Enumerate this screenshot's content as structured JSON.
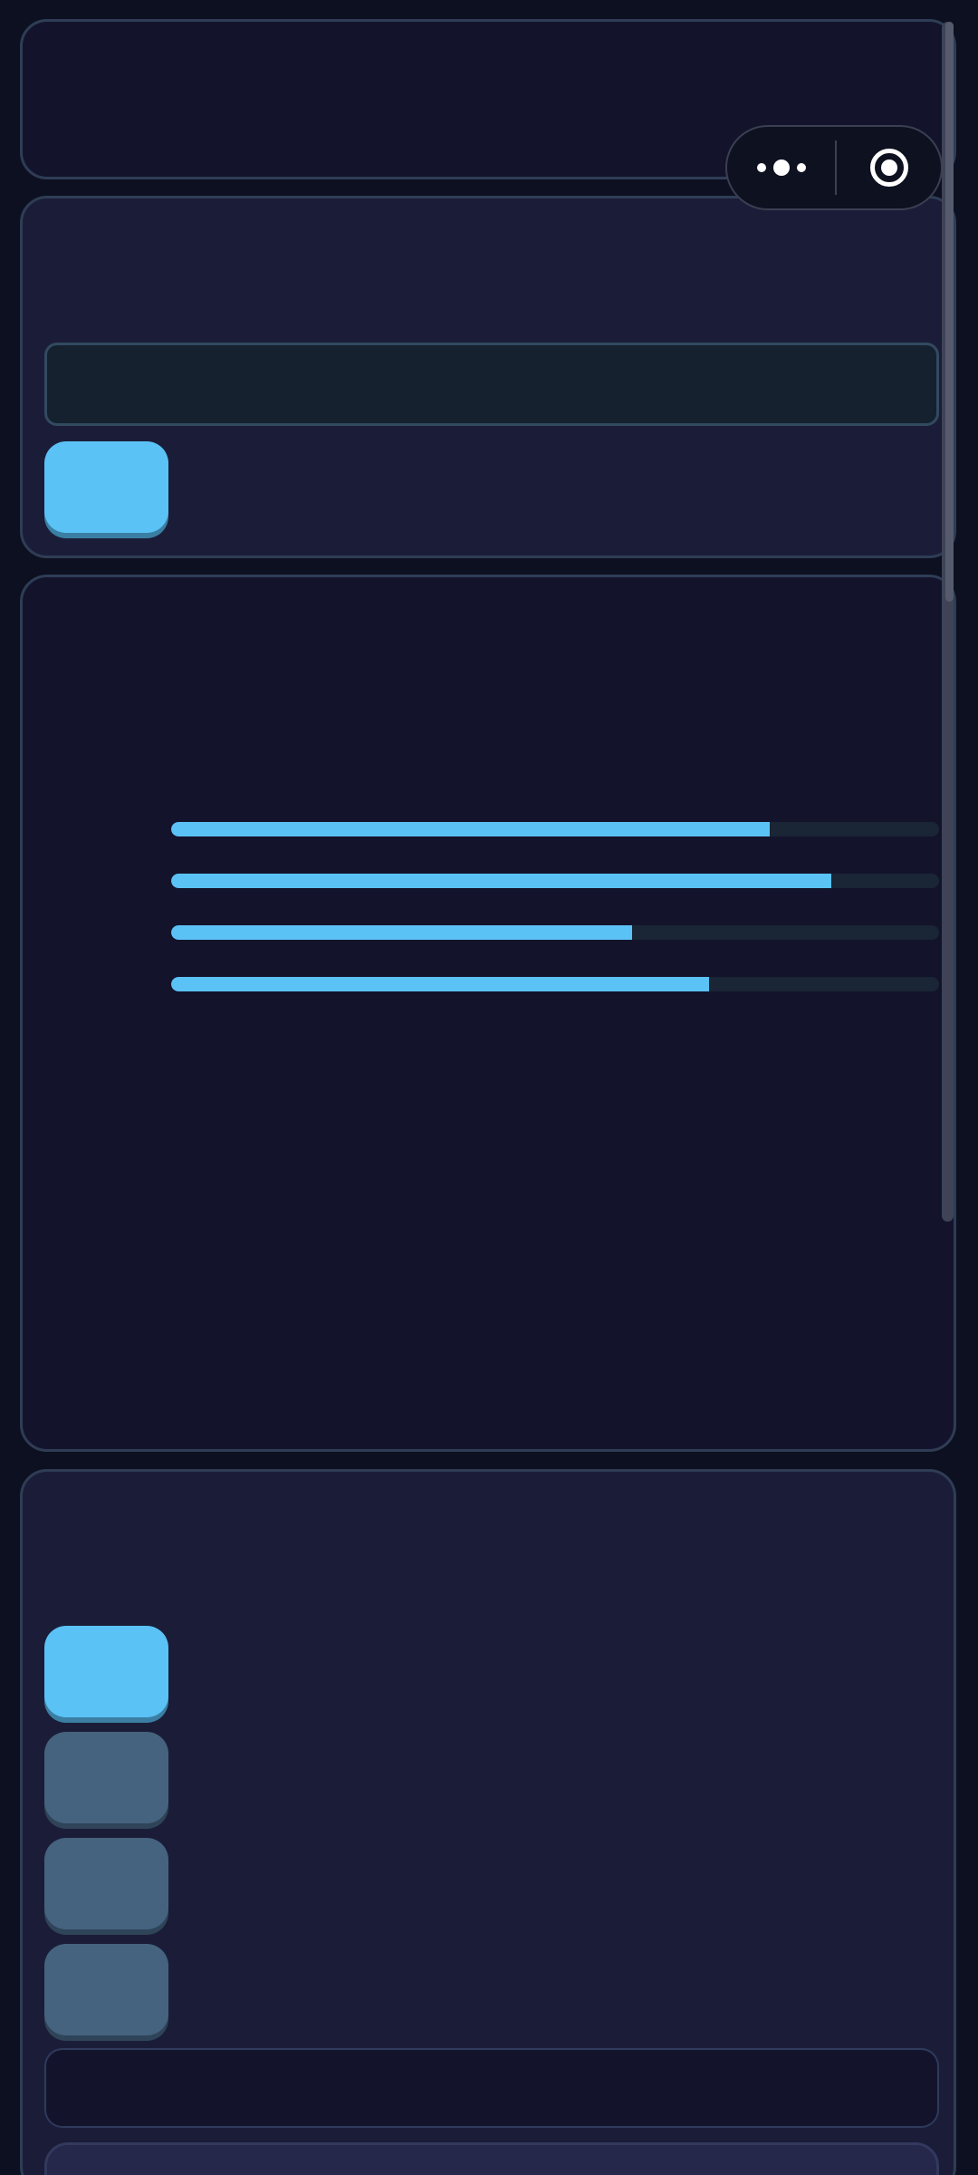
{
  "header": {},
  "input_card": {
    "text_field": {
      "value": "",
      "placeholder": ""
    },
    "primary_button": {
      "label": ""
    }
  },
  "progress_card": {
    "progress_bars": [
      {
        "value": 0.78,
        "label": ""
      },
      {
        "value": 0.86,
        "label": ""
      },
      {
        "value": 0.6,
        "label": ""
      },
      {
        "value": 0.7,
        "label": ""
      }
    ]
  },
  "options_card": {
    "options": [
      {
        "label": "",
        "selected": true
      },
      {
        "label": "",
        "selected": false
      },
      {
        "label": "",
        "selected": false
      },
      {
        "label": "",
        "selected": false
      }
    ],
    "text_field": {
      "value": "",
      "placeholder": ""
    }
  },
  "capsule": {
    "more_icon": "more-dots-icon",
    "close_icon": "close-target-icon"
  },
  "colors": {
    "background": "#0d1020",
    "card_dark": "#13142c",
    "card_light": "#1b1d38",
    "border": "#2e3d55",
    "accent": "#5bc2f6",
    "accent_shadow": "#3a7fa3",
    "secondary_button": "#45637f",
    "bar_track": "#1a2536"
  }
}
